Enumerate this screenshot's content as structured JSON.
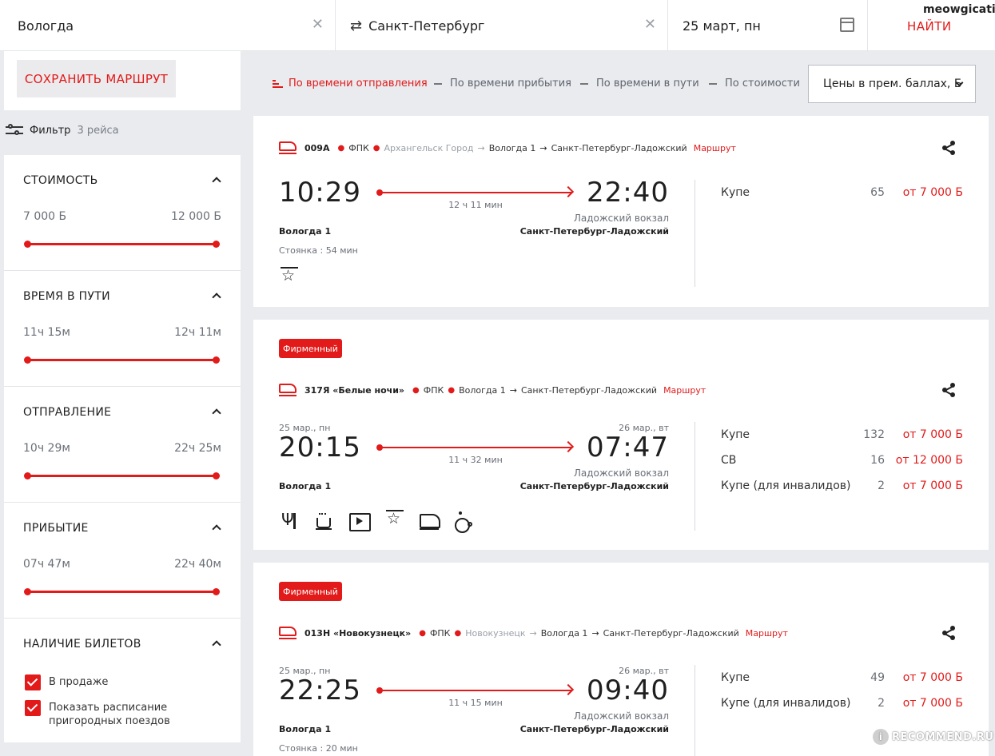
{
  "user": {
    "name": "meowgicatie"
  },
  "search": {
    "from": "Вологда",
    "to": "Санкт-Петербург",
    "date": "25 март, пн",
    "find_label": "НАЙТИ"
  },
  "sidebar": {
    "save_label": "СОХРАНИТЬ МАРШРУТ",
    "filter_label": "Фильтр",
    "filter_count": "3 рейса",
    "sections": [
      {
        "title": "СТОИМОСТЬ",
        "min": "7 000 Б",
        "max": "12 000 Б"
      },
      {
        "title": "ВРЕМЯ В ПУТИ",
        "min": "11ч 15м",
        "max": "12ч 11м"
      },
      {
        "title": "ОТПРАВЛЕНИЕ",
        "min": "10ч 29м",
        "max": "22ч 25м"
      },
      {
        "title": "ПРИБЫТИЕ",
        "min": "07ч 47м",
        "max": "22ч 40м"
      }
    ],
    "availability": {
      "title": "НАЛИЧИЕ БИЛЕТОВ",
      "options": [
        "В продаже",
        "Показать расписание пригородных поездов"
      ]
    }
  },
  "sorting": {
    "options": [
      "По времени отправления",
      "По времени прибытия",
      "По времени в пути",
      "По стоимости"
    ],
    "active_index": 0,
    "currency_select": "Цены в прем. баллах, Б"
  },
  "trains": [
    {
      "badge": "",
      "number": "009А",
      "company": "ФПК",
      "origin": "Архангельск Город",
      "from_station": "Вологда 1",
      "to_station": "Санкт-Петербург-Ладожский",
      "route_label": "Маршрут",
      "dep_date": "",
      "arr_date": "",
      "dep_time": "10:29",
      "arr_time": "22:40",
      "duration": "12 ч 11 мин",
      "arr_terminal": "Ладожский вокзал",
      "from_name": "Вологда 1",
      "to_name": "Санкт-Петербург-Ладожский",
      "stop": "Стоянка : 54 мин",
      "amenities": [
        "star-icon"
      ],
      "fares": [
        {
          "class": "Купе",
          "seats": "65",
          "price": "от 7 000 Б"
        }
      ]
    },
    {
      "badge": "Фирменный",
      "number": "317Я «Белые ночи»",
      "company": "ФПК",
      "origin": "",
      "from_station": "Вологда 1",
      "to_station": "Санкт-Петербург-Ладожский",
      "route_label": "Маршрут",
      "dep_date": "25 мар., пн",
      "arr_date": "26 мар., вт",
      "dep_time": "20:15",
      "arr_time": "07:47",
      "duration": "11 ч 32 мин",
      "arr_terminal": "Ладожский вокзал",
      "from_name": "Вологда 1",
      "to_name": "Санкт-Петербург-Ладожский",
      "stop": "",
      "amenities": [
        "restaurant-icon",
        "coffee-icon",
        "video-icon",
        "star-icon",
        "train-icon",
        "wheelchair-icon"
      ],
      "fares": [
        {
          "class": "Купе",
          "seats": "132",
          "price": "от 7 000 Б"
        },
        {
          "class": "СВ",
          "seats": "16",
          "price": "от 12 000 Б"
        },
        {
          "class": "Купе (для инвалидов)",
          "seats": "2",
          "price": "от 7 000 Б"
        }
      ]
    },
    {
      "badge": "Фирменный",
      "number": "013Н «Новокузнецк»",
      "company": "ФПК",
      "origin": "Новокузнецк",
      "from_station": "Вологда 1",
      "to_station": "Санкт-Петербург-Ладожский",
      "route_label": "Маршрут",
      "dep_date": "25 мар., пн",
      "arr_date": "26 мар., вт",
      "dep_time": "22:25",
      "arr_time": "09:40",
      "duration": "11 ч 15 мин",
      "arr_terminal": "Ладожский вокзал",
      "from_name": "Вологда 1",
      "to_name": "Санкт-Петербург-Ладожский",
      "stop": "Стоянка : 20 мин",
      "amenities": [],
      "fares": [
        {
          "class": "Купе",
          "seats": "49",
          "price": "от 7 000 Б"
        },
        {
          "class": "Купе (для инвалидов)",
          "seats": "2",
          "price": "от 7 000 Б"
        }
      ]
    }
  ],
  "watermark": "RECOMMEND.RU",
  "colors": {
    "accent": "#e21a1a",
    "background": "#e9ebef"
  }
}
